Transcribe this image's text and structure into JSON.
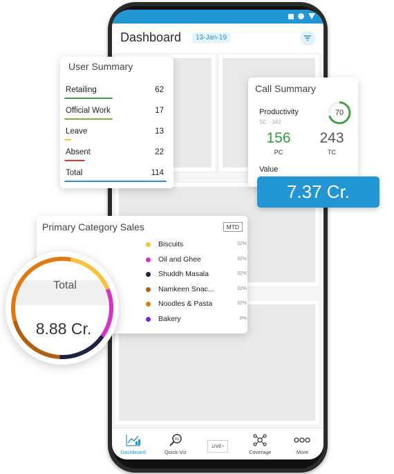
{
  "header": {
    "title": "Dashboard",
    "date": "13-Jan-19"
  },
  "user_summary": {
    "title": "User Summary",
    "rows": [
      {
        "label": "Retailing",
        "value": "62",
        "color": "#43a047"
      },
      {
        "label": "Official Work",
        "value": "17",
        "color": "#7cb342"
      },
      {
        "label": "Leave",
        "value": "13",
        "color": "#fbc02d"
      },
      {
        "label": "Absent",
        "value": "22",
        "color": "#e53935"
      },
      {
        "label": "Total",
        "value": "114",
        "color": "#2196d3"
      }
    ]
  },
  "call_summary": {
    "title": "Call Summary",
    "productivity_label": "Productivity",
    "productivity_sub": "SC - 342",
    "productivity_value": "70",
    "productivity_fraction": 0.7,
    "pc_value": "156",
    "pc_label": "PC",
    "tc_value": "243",
    "tc_label": "TC",
    "value_label": "Value",
    "value_amount": "7.37 Cr."
  },
  "category_sales": {
    "title": "Primary Category Sales",
    "period": "MTD",
    "total_label": "Total",
    "total_amount": "8.88 Cr.",
    "items": [
      {
        "name": "Biscuits",
        "pct": "32%",
        "color": "#f9c23c"
      },
      {
        "name": "Oil and Ghee",
        "pct": "32%",
        "color": "#d633c4"
      },
      {
        "name": "Shuddh Masala",
        "pct": "32%",
        "color": "#1b2340"
      },
      {
        "name": "Namkeen Snac...",
        "pct": "32%",
        "color": "#b35f12"
      },
      {
        "name": "Noodles & Pasta",
        "pct": "32%",
        "color": "#e07a12"
      },
      {
        "name": "Bakery",
        "pct": "0%",
        "color": "#7b1fd2"
      }
    ]
  },
  "nav": {
    "items": [
      {
        "label": "Dashboard",
        "icon": "chart-icon"
      },
      {
        "label": "Quick-Viz",
        "icon": "magnifier-icon"
      },
      {
        "label": "LIVE",
        "icon": "live-icon"
      },
      {
        "label": "Coverage",
        "icon": "network-icon"
      },
      {
        "label": "More",
        "icon": "more-icon"
      }
    ]
  },
  "colors": {
    "accent": "#2196d3",
    "productivity_ring": "#43a047"
  }
}
